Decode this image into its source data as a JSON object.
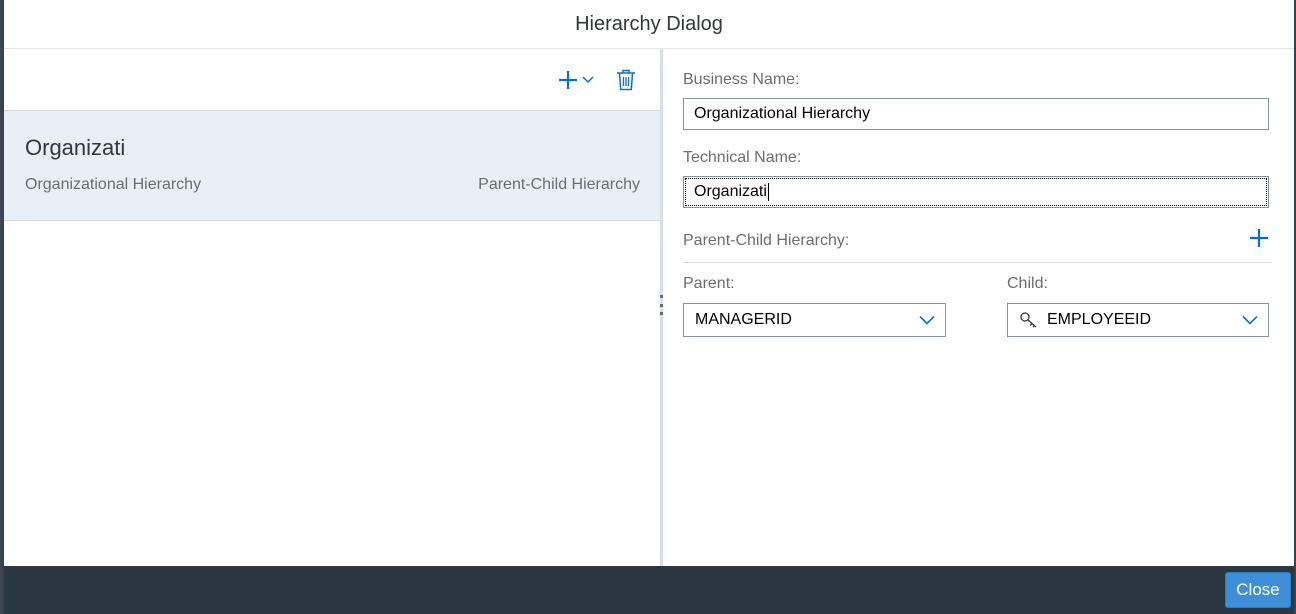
{
  "dialog": {
    "title": "Hierarchy Dialog"
  },
  "list": {
    "items": [
      {
        "title": "Organizati",
        "description": "Organizational Hierarchy",
        "info": "Parent-Child Hierarchy"
      }
    ]
  },
  "form": {
    "business_name_label": "Business Name:",
    "business_name_value": "Organizational Hierarchy",
    "technical_name_label": "Technical Name:",
    "technical_name_value": "Organizati",
    "section_title": "Parent-Child Hierarchy:",
    "parent_label": "Parent:",
    "parent_value": "MANAGERID",
    "child_label": "Child:",
    "child_value": "EMPLOYEEID"
  },
  "footer": {
    "close_label": "Close"
  },
  "icons": {
    "add": "add-icon",
    "dropdown": "chevron-down-icon",
    "delete": "trash-icon",
    "key": "key-icon"
  },
  "colors": {
    "accent": "#0a6ed1",
    "selected_row": "#e8f0f7",
    "footer": "#2b3741",
    "button": "#3f8fd8"
  }
}
